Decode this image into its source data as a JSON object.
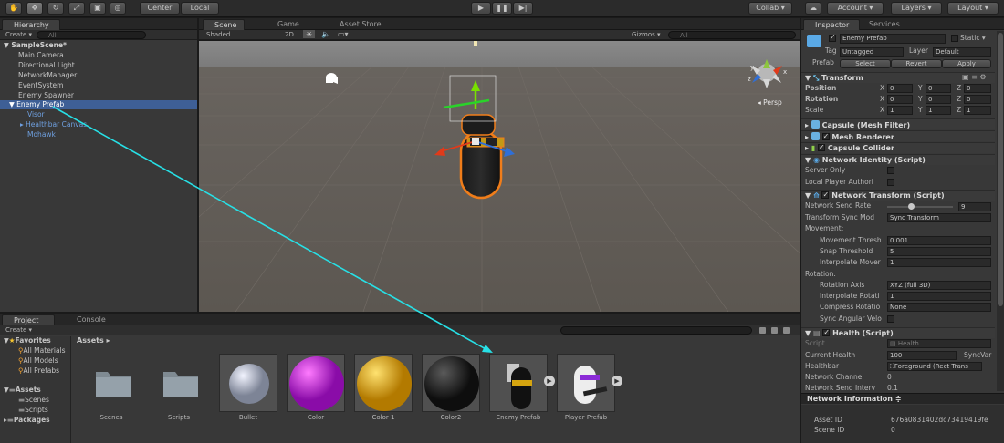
{
  "toolbar": {
    "pivot": "Center",
    "space": "Local",
    "collab": "Collab ▾",
    "account": "Account ▾",
    "layers": "Layers ▾",
    "layout": "Layout ▾"
  },
  "hierarchy": {
    "tab": "Hierarchy",
    "create": "Create ▾",
    "search_placeholder": "All",
    "scene": "SampleScene*",
    "items": [
      "Main Camera",
      "Directional Light",
      "NetworkManager",
      "EventSystem",
      "Enemy Spawner",
      "Enemy Prefab",
      "Visor",
      "Healthbar Canvas",
      "Mohawk"
    ]
  },
  "scene_view": {
    "tabs": [
      "Scene",
      "Game",
      "Asset Store"
    ],
    "shading": "Shaded",
    "mode_2d": "2D",
    "gizmos": "Gizmos ▾",
    "search_placeholder": "All",
    "persp": "Persp",
    "axis_labels": [
      "y",
      "x",
      "z"
    ]
  },
  "project": {
    "tabs": [
      "Project",
      "Console"
    ],
    "create": "Create ▾",
    "favorites": "Favorites",
    "favorite_items": [
      "All Materials",
      "All Models",
      "All Prefabs"
    ],
    "assets": "Assets",
    "asset_folders": [
      "Scenes",
      "Scripts"
    ],
    "packages": "Packages",
    "breadcrumb": "Assets ▸",
    "tiles": [
      "Scenes",
      "Scripts",
      "Bullet",
      "Color",
      "Color 1",
      "Color2",
      "Enemy Prefab",
      "Player Prefab"
    ]
  },
  "inspector": {
    "tabs": [
      "Inspector",
      "Services"
    ],
    "object_name": "Enemy Prefab",
    "static": "Static",
    "tag_label": "Tag",
    "tag_value": "Untagged",
    "layer_label": "Layer",
    "layer_value": "Default",
    "prefab_label": "Prefab",
    "prefab_buttons": [
      "Select",
      "Revert",
      "Apply"
    ],
    "transform": {
      "title": "Transform",
      "rows": [
        {
          "label": "Position",
          "x": "0",
          "y": "0",
          "z": "0"
        },
        {
          "label": "Rotation",
          "x": "0",
          "y": "0",
          "z": "0"
        },
        {
          "label": "Scale",
          "x": "1",
          "y": "1",
          "z": "1"
        }
      ]
    },
    "components": [
      "Capsule (Mesh Filter)",
      "Mesh Renderer",
      "Capsule Collider"
    ],
    "network_identity": {
      "title": "Network Identity (Script)",
      "server_only": "Server Only",
      "local_player": "Local Player Authori"
    },
    "network_transform": {
      "title": "Network Transform (Script)",
      "send_rate_label": "Network Send Rate",
      "send_rate_value": "9",
      "send_rate_fraction": 0.35,
      "sync_mode_label": "Transform Sync Mod",
      "sync_mode_value": "Sync Transform",
      "movement": "Movement:",
      "movement_threshold_label": "Movement Thresh",
      "movement_threshold_value": "0.001",
      "snap_threshold_label": "Snap Threshold",
      "snap_threshold_value": "5",
      "interpolate_movement_label": "Interpolate Mover",
      "interpolate_movement_value": "1",
      "rotation": "Rotation:",
      "rotation_axis_label": "Rotation Axis",
      "rotation_axis_value": "XYZ (full 3D)",
      "interpolate_rotation_label": "Interpolate Rotati",
      "interpolate_rotation_value": "1",
      "compress_rotation_label": "Compress Rotatio",
      "compress_rotation_value": "None",
      "sync_angular_label": "Sync Angular Velo"
    },
    "health": {
      "title": "Health (Script)",
      "script_label": "Script",
      "script_value": "Health",
      "current_health_label": "Current Health",
      "current_health_value": "100",
      "sync_var": "SyncVar",
      "healthbar_label": "Healthbar",
      "healthbar_value": "Foreground (Rect Trans",
      "network_channel_label": "Network Channel",
      "network_channel_value": "0",
      "network_send_interval_label": "Network Send Interv",
      "network_send_interval_value": "0.1"
    },
    "network_information": "Network Information",
    "asset_id_label": "Asset ID",
    "asset_id_value": "676a0831402dc73419419fe",
    "scene_id_label": "Scene ID",
    "scene_id_value": "0"
  }
}
